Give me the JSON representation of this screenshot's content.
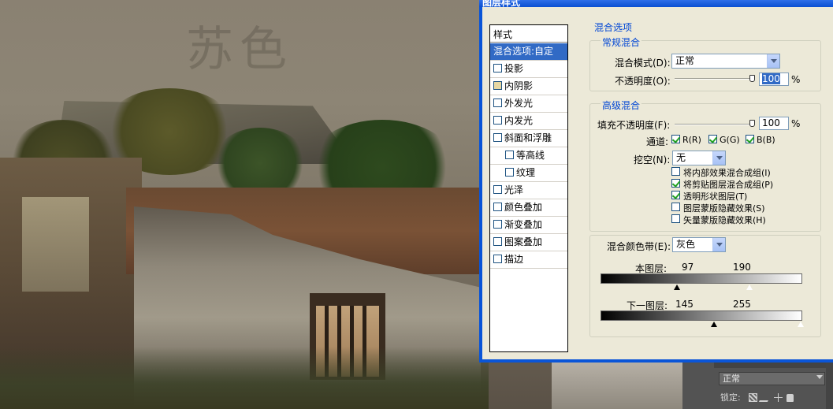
{
  "window": {
    "title": "图层样式",
    "watermark": "苏色"
  },
  "styles": {
    "header": "样式",
    "items": [
      {
        "label": "混合选项:自定",
        "selected": true,
        "checkbox": false,
        "checked": false,
        "indent": false
      },
      {
        "label": "投影",
        "selected": false,
        "checkbox": true,
        "checked": false,
        "indent": false
      },
      {
        "label": "内阴影",
        "selected": false,
        "checkbox": true,
        "checked": false,
        "indent": false,
        "tan": true
      },
      {
        "label": "外发光",
        "selected": false,
        "checkbox": true,
        "checked": false,
        "indent": false
      },
      {
        "label": "内发光",
        "selected": false,
        "checkbox": true,
        "checked": false,
        "indent": false
      },
      {
        "label": "斜面和浮雕",
        "selected": false,
        "checkbox": true,
        "checked": false,
        "indent": false
      },
      {
        "label": "等高线",
        "selected": false,
        "checkbox": true,
        "checked": false,
        "indent": true
      },
      {
        "label": "纹理",
        "selected": false,
        "checkbox": true,
        "checked": false,
        "indent": true
      },
      {
        "label": "光泽",
        "selected": false,
        "checkbox": true,
        "checked": false,
        "indent": false
      },
      {
        "label": "颜色叠加",
        "selected": false,
        "checkbox": true,
        "checked": false,
        "indent": false
      },
      {
        "label": "渐变叠加",
        "selected": false,
        "checkbox": true,
        "checked": false,
        "indent": false
      },
      {
        "label": "图案叠加",
        "selected": false,
        "checkbox": true,
        "checked": false,
        "indent": false
      },
      {
        "label": "描边",
        "selected": false,
        "checkbox": true,
        "checked": false,
        "indent": false
      }
    ]
  },
  "blending": {
    "section_title": "混合选项",
    "general": {
      "title": "常规混合",
      "mode_label": "混合模式(D):",
      "mode_value": "正常",
      "opacity_label": "不透明度(O):",
      "opacity_value": "100",
      "opacity_unit": "%"
    },
    "advanced": {
      "title": "高级混合",
      "fill_label": "填充不透明度(F):",
      "fill_value": "100",
      "fill_unit": "%",
      "channels_label": "通道:",
      "channels": [
        {
          "label": "R(R)",
          "checked": true
        },
        {
          "label": "G(G)",
          "checked": true
        },
        {
          "label": "B(B)",
          "checked": true
        }
      ],
      "knockout_label": "挖空(N):",
      "knockout_value": "无",
      "options": [
        {
          "label": "将内部效果混合成组(I)",
          "checked": false
        },
        {
          "label": "将剪贴图层混合成组(P)",
          "checked": true
        },
        {
          "label": "透明形状图层(T)",
          "checked": true
        },
        {
          "label": "图层蒙版隐藏效果(S)",
          "checked": false
        },
        {
          "label": "矢量蒙版隐藏效果(H)",
          "checked": false
        }
      ]
    },
    "blend_if": {
      "label": "混合颜色带(E):",
      "value": "灰色",
      "this_layer": {
        "label": "本图层:",
        "low": "97",
        "high": "190",
        "low_level": 97,
        "high_level": 190
      },
      "underlying": {
        "label": "下一图层:",
        "low": "145",
        "high": "255",
        "low_level": 145,
        "high_level": 255
      }
    }
  },
  "layers_panel": {
    "mode_value": "正常",
    "lock_label": "锁定:"
  }
}
